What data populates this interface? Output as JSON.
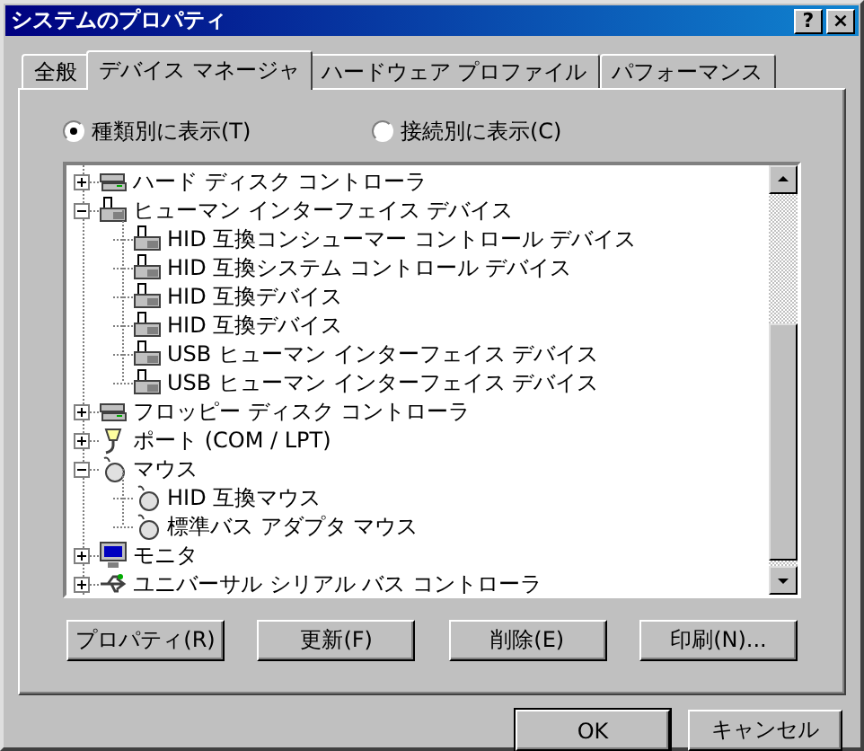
{
  "window": {
    "title": "システムのプロパティ",
    "help": "?",
    "close": "×"
  },
  "tabs": [
    {
      "label": "全般",
      "selected": false
    },
    {
      "label": "デバイス マネージャ",
      "selected": true
    },
    {
      "label": "ハードウェア プロファイル",
      "selected": false
    },
    {
      "label": "パフォーマンス",
      "selected": false
    }
  ],
  "view_options": [
    {
      "label": "種類別に表示(T)",
      "selected": true
    },
    {
      "label": "接続別に表示(C)",
      "selected": false
    }
  ],
  "devices": [
    {
      "label": "ハード ディスク コントローラ",
      "kind": "disk",
      "expanded": false
    },
    {
      "label": "ヒューマン インターフェイス デバイス",
      "kind": "hid",
      "expanded": true,
      "children": [
        {
          "label": "HID 互換コンシューマー コントロール デバイス",
          "kind": "hid"
        },
        {
          "label": "HID 互換システム コントロール デバイス",
          "kind": "hid"
        },
        {
          "label": "HID 互換デバイス",
          "kind": "hid"
        },
        {
          "label": "HID 互換デバイス",
          "kind": "hid"
        },
        {
          "label": "USB ヒューマン インターフェイス デバイス",
          "kind": "hid"
        },
        {
          "label": "USB ヒューマン インターフェイス デバイス",
          "kind": "hid"
        }
      ]
    },
    {
      "label": "フロッピー ディスク コントローラ",
      "kind": "disk",
      "expanded": false
    },
    {
      "label": "ポート (COM / LPT)",
      "kind": "port",
      "expanded": false
    },
    {
      "label": "マウス",
      "kind": "mouse",
      "expanded": true,
      "children": [
        {
          "label": "HID 互換マウス",
          "kind": "mouse"
        },
        {
          "label": "標準バス アダプタ マウス",
          "kind": "mouse"
        }
      ]
    },
    {
      "label": "モニタ",
      "kind": "monitor",
      "expanded": false
    },
    {
      "label": "ユニバーサル シリアル バス コントローラ",
      "kind": "usb",
      "expanded": false
    }
  ],
  "actions": [
    "プロパティ(R)",
    "更新(F)",
    "削除(E)",
    "印刷(N)..."
  ],
  "footer_buttons": [
    {
      "label": "OK",
      "default": true
    },
    {
      "label": "キャンセル",
      "default": false
    }
  ]
}
